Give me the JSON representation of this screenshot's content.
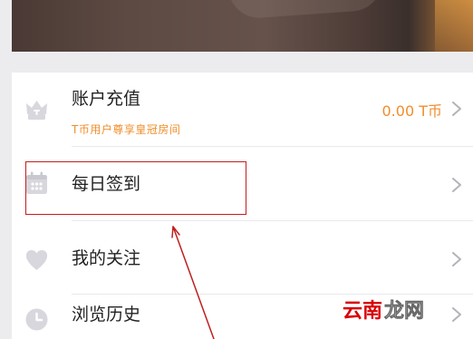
{
  "list": {
    "items": [
      {
        "label": "账户充值",
        "subtitle": "T币用户尊享皇冠房间",
        "value": "0.00 T币",
        "icon": "crown-icon"
      },
      {
        "label": "每日签到",
        "icon": "calendar-icon"
      },
      {
        "label": "我的关注",
        "icon": "heart-icon"
      },
      {
        "label": "浏览历史",
        "icon": "clock-icon"
      }
    ]
  },
  "annotation": {
    "box_color": "#bf1f1f",
    "arrow_color": "#bf1f1f"
  },
  "watermark": {
    "text": "云南龙网",
    "text_part_1": "云南",
    "text_part_2": "龙网",
    "accent_color": "#d90007"
  },
  "colors": {
    "accent": "#f08e2b",
    "text_primary": "#222222",
    "icon_gray": "#d7d7dd",
    "background": "#ececef"
  }
}
